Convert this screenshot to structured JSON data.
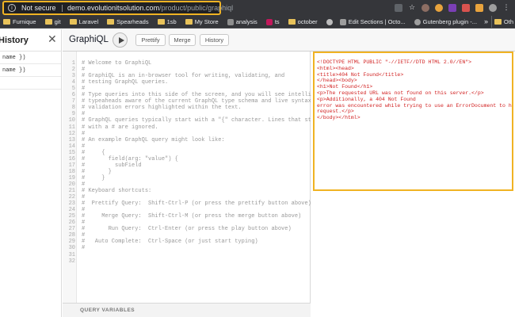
{
  "browser": {
    "security_label": "Not secure",
    "url_host": "demo.evolutionitsolution.com",
    "url_path": "/product/public/graphiql",
    "extension_icons": [
      "camera-icon",
      "star-icon",
      "cookie-icon",
      "extension-icon",
      "extension-icon",
      "extension-icon",
      "puzzle-icon",
      "profile-icon",
      "menu-icon"
    ]
  },
  "bookmarks": {
    "items": [
      "Furnique",
      "git",
      "Laravel",
      "Spearheads",
      "1sb",
      "My Store",
      "analysis",
      "ts",
      "october",
      "",
      "Edit Sections | Octo...",
      "Gutenberg plugin -..."
    ],
    "more_label": "»",
    "other_label": "Oth"
  },
  "history": {
    "title": "History",
    "items": [
      "name })",
      "name })"
    ]
  },
  "toolbar": {
    "app_title": "GraphiQL",
    "prettify_label": "Prettify",
    "merge_label": "Merge",
    "history_label": "History"
  },
  "editor": {
    "lines": [
      "# Welcome to GraphiQL",
      "#",
      "# GraphiQL is an in-browser tool for writing, validating, and",
      "# testing GraphQL queries.",
      "#",
      "# Type queries into this side of the screen, and you will see intelligent",
      "# typeaheads aware of the current GraphQL type schema and live syntax and",
      "# validation errors highlighted within the text.",
      "#",
      "# GraphQL queries typically start with a \"{\" character. Lines that starts",
      "# with a # are ignored.",
      "#",
      "# An example GraphQL query might look like:",
      "#",
      "#     {",
      "#       field(arg: \"value\") {",
      "#         subField",
      "#       }",
      "#     }",
      "#",
      "# Keyboard shortcuts:",
      "#",
      "#  Prettify Query:  Shift-Ctrl-P (or press the prettify button above)",
      "#",
      "#     Merge Query:  Shift-Ctrl-M (or press the merge button above)",
      "#",
      "#       Run Query:  Ctrl-Enter (or press the play button above)",
      "#",
      "#   Auto Complete:  Ctrl-Space (or just start typing)",
      "#",
      "",
      ""
    ],
    "query_variables_label": "QUERY VARIABLES"
  },
  "result": {
    "lines": [
      "<!DOCTYPE HTML PUBLIC \"-//IETF//DTD HTML 2.0//EN\">",
      "<html><head>",
      "<title>404 Not Found</title>",
      "</head><body>",
      "<h1>Not Found</h1>",
      "<p>The requested URL was not found on this server.</p>",
      "<p>Additionally, a 404 Not Found",
      "error was encountered while trying to use an ErrorDocument to handle the",
      "request.</p>",
      "</body></html>"
    ]
  },
  "colors": {
    "highlight": "#f0b323",
    "error_text": "#d12020",
    "comment_text": "#999999"
  }
}
